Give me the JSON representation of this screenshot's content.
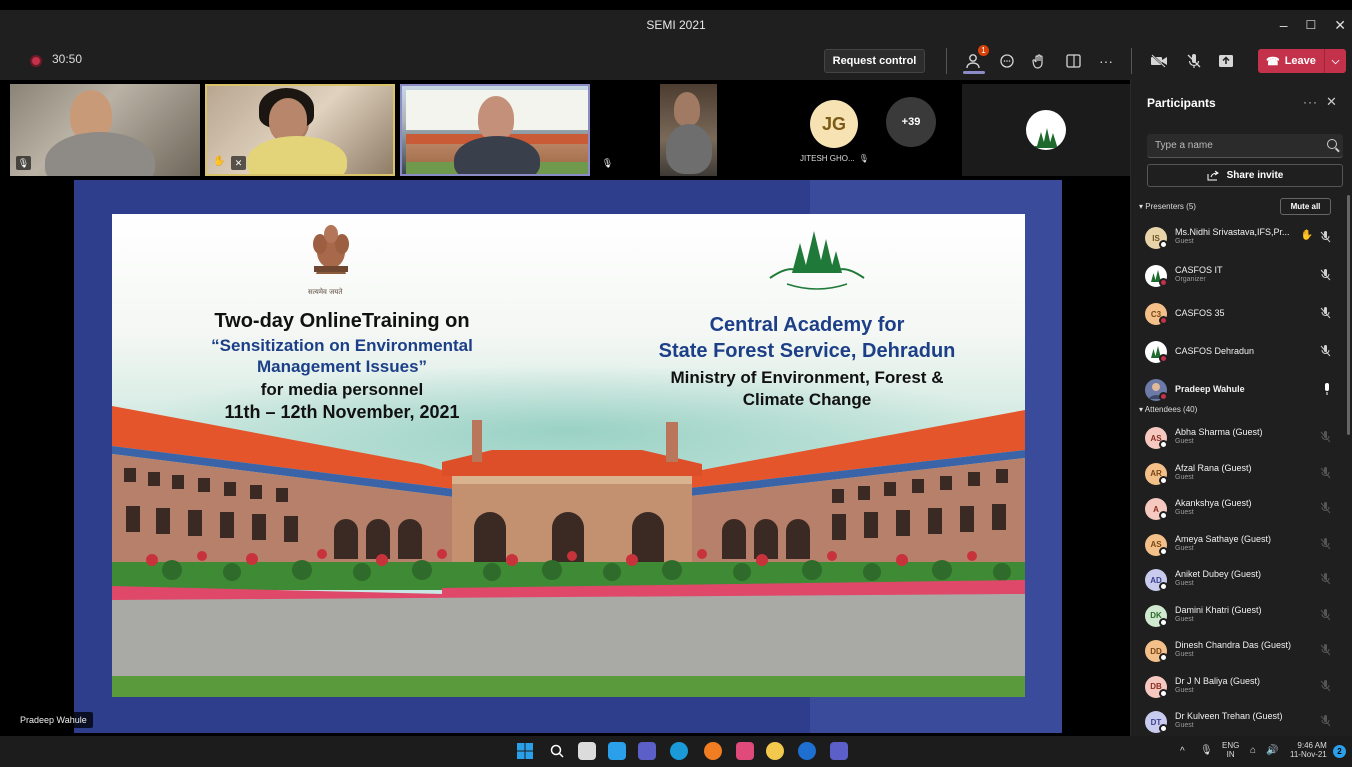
{
  "window": {
    "title": "SEMI 2021",
    "controls": [
      "–",
      "☐",
      "✕"
    ]
  },
  "toolbar": {
    "timer": "30:50",
    "request_control": "Request control",
    "leave": "Leave",
    "participants_badge": "1"
  },
  "strip": {
    "jg_initials": "JG",
    "jg_name": "JITESH GHO...",
    "overflow_count": "+39"
  },
  "slide": {
    "left": [
      "Two-day OnlineTraining on",
      "“Sensitization on Environmental",
      "Management Issues”",
      "for media personnel",
      "11th – 12th November, 2021"
    ],
    "right": [
      "Central Academy for",
      "State Forest Service, Dehradun",
      "Ministry of Environment, Forest &",
      "Climate Change"
    ],
    "emblem_caption": "सत्यमेव जयते"
  },
  "speaker_label": "Pradeep Wahule",
  "panel": {
    "title": "Participants",
    "search_placeholder": "Type a name",
    "share_invite": "Share invite",
    "presenters_header": "Presenters (5)",
    "mute_all": "Mute all",
    "attendees_header": "Attendees (40)",
    "presenters": [
      {
        "initials": "IS",
        "name": "Ms.Nidhi Srivastava,IFS,Pr...",
        "role": "Guest",
        "color": "#e8d4a8",
        "text_color": "#6a5320"
      },
      {
        "initials": "",
        "name": "CASFOS IT",
        "role": "Organizer",
        "color": "#ffffff",
        "text_color": "#1f6b2a"
      },
      {
        "initials": "C3",
        "name": "CASFOS 35",
        "role": "",
        "color": "#f3c08a",
        "text_color": "#7a4614"
      },
      {
        "initials": "",
        "name": "CASFOS Dehradun",
        "role": "",
        "color": "#ffffff",
        "text_color": "#1f6b2a"
      },
      {
        "initials": "",
        "name": "Pradeep Wahule",
        "role": "",
        "color": "#6c7aa8",
        "text_color": "#fff"
      }
    ],
    "attendees": [
      {
        "initials": "AS",
        "name": "Abha Sharma (Guest)",
        "role": "Guest",
        "color": "#f5c8c0",
        "text_color": "#8a2e22"
      },
      {
        "initials": "AR",
        "name": "Afzal Rana (Guest)",
        "role": "Guest",
        "color": "#f3c08a",
        "text_color": "#7a4614"
      },
      {
        "initials": "A",
        "name": "Akankshya (Guest)",
        "role": "Guest",
        "color": "#f5c8c0",
        "text_color": "#8a2e22"
      },
      {
        "initials": "AS",
        "name": "Ameya Sathaye (Guest)",
        "role": "Guest",
        "color": "#f3c08a",
        "text_color": "#7a4614"
      },
      {
        "initials": "AD",
        "name": "Aniket Dubey (Guest)",
        "role": "Guest",
        "color": "#c9cbee",
        "text_color": "#3c3f8f"
      },
      {
        "initials": "DK",
        "name": "Damini Khatri (Guest)",
        "role": "Guest",
        "color": "#cfe8cf",
        "text_color": "#2b6b2b"
      },
      {
        "initials": "DD",
        "name": "Dinesh Chandra Das (Guest)",
        "role": "Guest",
        "color": "#f3c08a",
        "text_color": "#7a4614"
      },
      {
        "initials": "DB",
        "name": "Dr J N Baliya (Guest)",
        "role": "Guest",
        "color": "#f5c8c0",
        "text_color": "#8a2e22"
      },
      {
        "initials": "DT",
        "name": "Dr Kulveen Trehan (Guest)",
        "role": "Guest",
        "color": "#c9cbee",
        "text_color": "#3c3f8f"
      }
    ]
  },
  "taskbar": {
    "lang_top": "ENG",
    "lang_bottom": "IN",
    "time": "9:46 AM",
    "date": "11-Nov-21",
    "notif_count": "2"
  }
}
